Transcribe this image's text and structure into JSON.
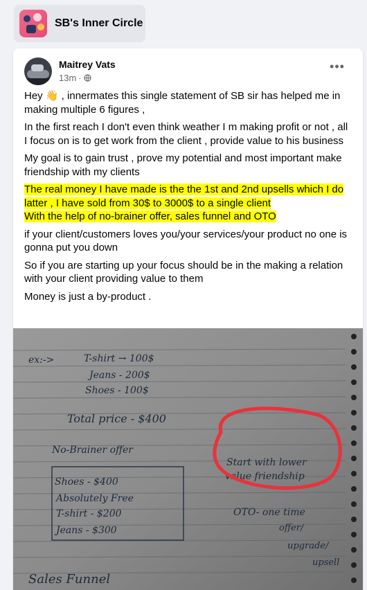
{
  "group": {
    "name": "SB's Inner Circle"
  },
  "post": {
    "author": "Maitrey Vats",
    "time": "13m",
    "dot": "·",
    "more": "•••",
    "paragraphs": [
      "Hey 👋 , innermates this single statement of SB sir has helped me in making multiple 6 figures ,",
      "In the first reach I don't even think weather I m making profit or not , all I focus on is to get work from the client , provide value to his business",
      "My goal is to gain trust , prove my potential and most important make friendship with my clients"
    ],
    "highlighted": [
      "The real money I have made is the the 1st and 2nd upsells which I do latter , I have sold from 30$ to 3000$ to a single client",
      "With the help of no-brainer offer, sales funnel and OTO"
    ],
    "paragraphs_after": [
      "if your client/customers loves you/your services/your product no one is gonna put you down",
      "So if you are starting up your focus should be in the making a relation with your client providing value to them",
      "Money is just a by-product ."
    ]
  },
  "notebook": {
    "row1_a": "ex:->",
    "row1_b": "T-shirt → 100$",
    "row2": "Jeans  -  200$",
    "row3": "Shoes  -  100$",
    "total": "Total price - $400",
    "offer": "No-Brainer offer",
    "circle_line1": "Start with lower",
    "circle_line2": "value friendship",
    "box_row1": "Shoes -  $400",
    "box_row2": "Absolutely  Free",
    "box_row3": "T-shirt  -  $200",
    "box_row4": "Jeans  -  $300",
    "oto_line1": "OTO- one time",
    "oto_line2": "offer/",
    "oto_line3": "upgrade/",
    "oto_line4": "upsell",
    "funnel": "Sales Funnel"
  },
  "colors": {
    "highlight": "#ffff00",
    "marker_red": "#e8333c",
    "background": "#f0f2f5"
  }
}
